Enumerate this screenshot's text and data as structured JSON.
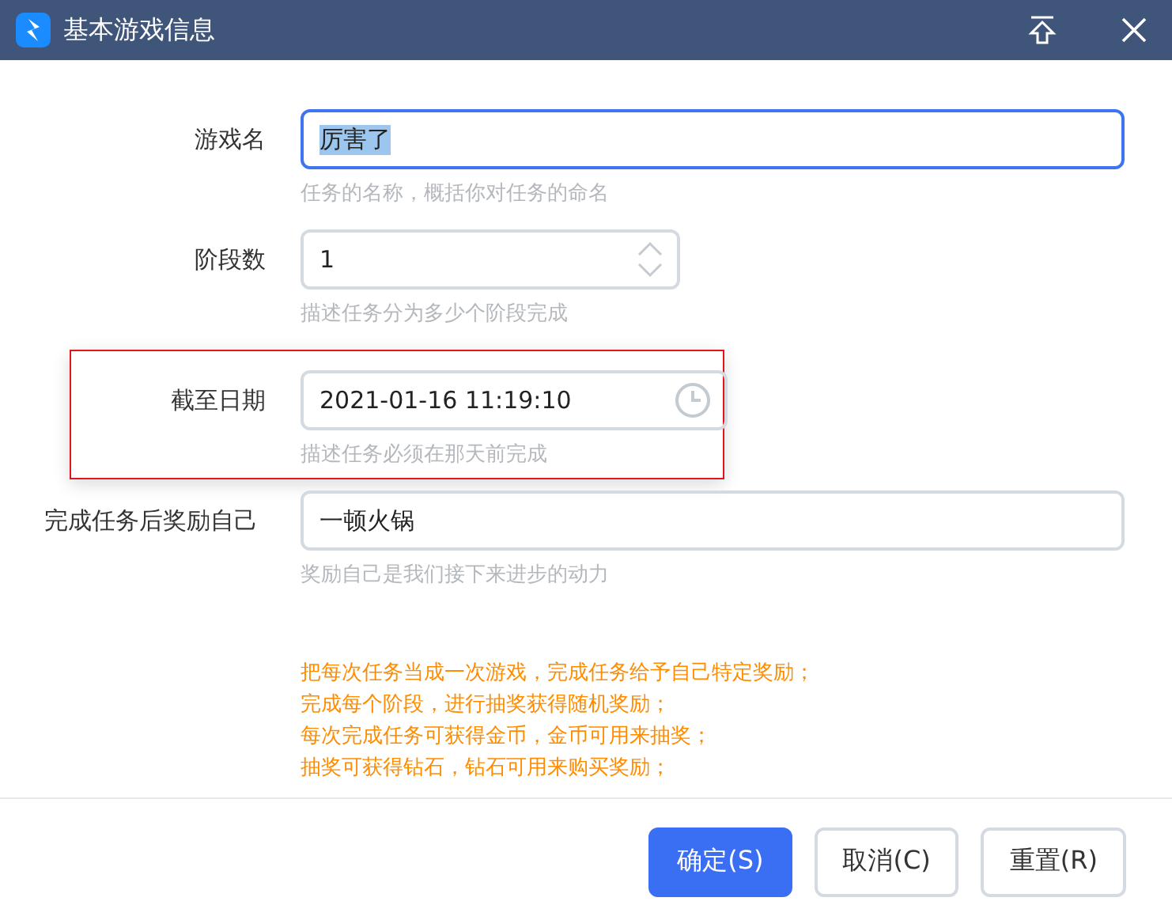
{
  "window": {
    "title": "基本游戏信息"
  },
  "fields": [
    {
      "kind": "text",
      "label": "游戏名",
      "value": "厉害了",
      "hint": "任务的名称，概括你对任务的命名",
      "focused": true,
      "highlighted": false
    },
    {
      "kind": "number",
      "label": "阶段数",
      "value": "1",
      "hint": "描述任务分为多少个阶段完成",
      "focused": false,
      "highlighted": false
    },
    {
      "kind": "datetime",
      "label": "截至日期",
      "value": "2021-01-16 11:19:10",
      "hint": "描述任务必须在那天前完成",
      "focused": false,
      "highlighted": true
    },
    {
      "kind": "text",
      "label": "完成任务后奖励自己",
      "value": "一顿火锅",
      "hint": "奖励自己是我们接下来进步的动力",
      "focused": false,
      "highlighted": false
    }
  ],
  "notes": [
    "把每次任务当成一次游戏，完成任务给予自己特定奖励；",
    "完成每个阶段，进行抽奖获得随机奖励；",
    "每次完成任务可获得金币，金币可用来抽奖；",
    "抽奖可获得钻石，钻石可用来购买奖励；"
  ],
  "buttons": [
    {
      "label": "确定(S)",
      "primary": true
    },
    {
      "label": "取消(C)",
      "primary": false
    },
    {
      "label": "重置(R)",
      "primary": false
    }
  ]
}
